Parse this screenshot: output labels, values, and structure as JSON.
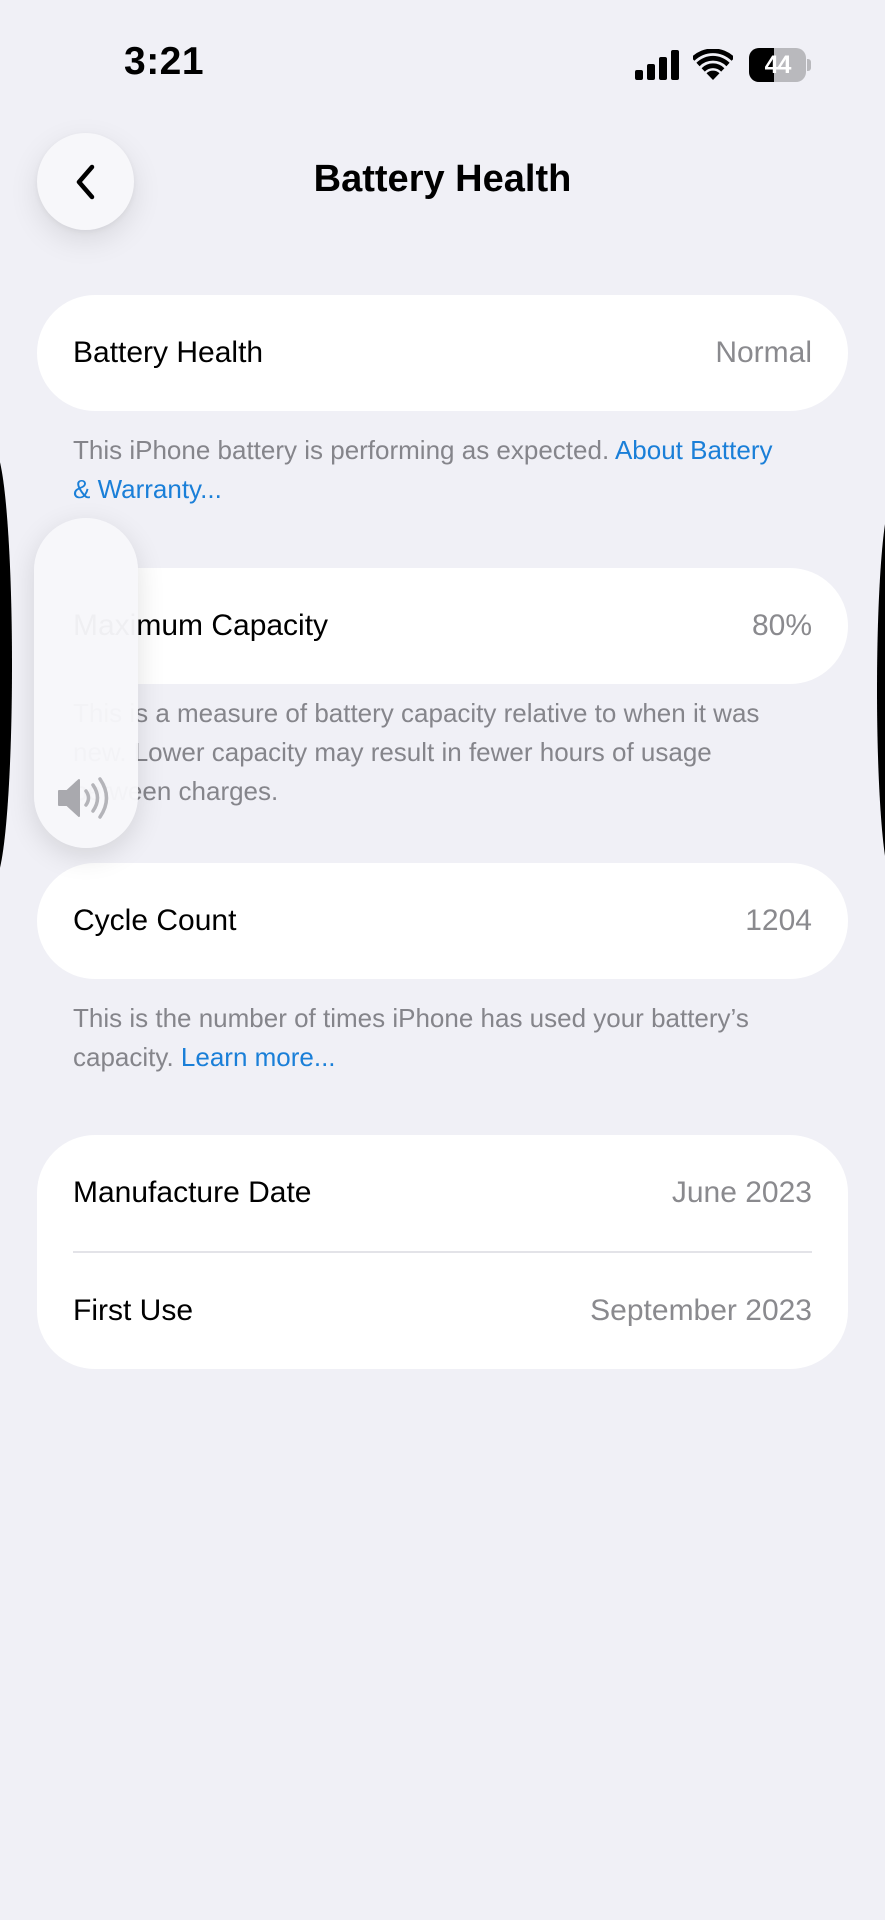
{
  "status_bar": {
    "time": "3:21",
    "battery_percent": 44,
    "battery_label": "44",
    "signal_icon": "cellular-signal-icon",
    "wifi_icon": "wifi-icon"
  },
  "nav": {
    "back_icon": "chevron-left-icon",
    "title": "Battery Health"
  },
  "battery_health": {
    "label": "Battery Health",
    "value": "Normal",
    "footnote": "This iPhone battery is performing as expected. ",
    "footnote_link": "About Battery & Warranty..."
  },
  "maximum_capacity": {
    "label": "Maximum Capacity",
    "value": "80%",
    "footnote": "This is a measure of battery capacity relative to when it was new. Lower capacity may result in fewer hours of usage between charges."
  },
  "cycle_count": {
    "label": "Cycle Count",
    "value": "1204",
    "footnote": "This is the number of times iPhone has used your battery’s capacity. ",
    "footnote_link": "Learn more..."
  },
  "dates": {
    "manufacture_label": "Manufacture Date",
    "manufacture_value": "June 2023",
    "first_use_label": "First Use",
    "first_use_value": "September 2023"
  },
  "volume_hud": {
    "icon": "speaker-volume-icon"
  },
  "colors": {
    "background": "#f0f0f6",
    "card": "#ffffff",
    "link": "#1a7fd8",
    "secondary_text": "#8a8a8e"
  }
}
